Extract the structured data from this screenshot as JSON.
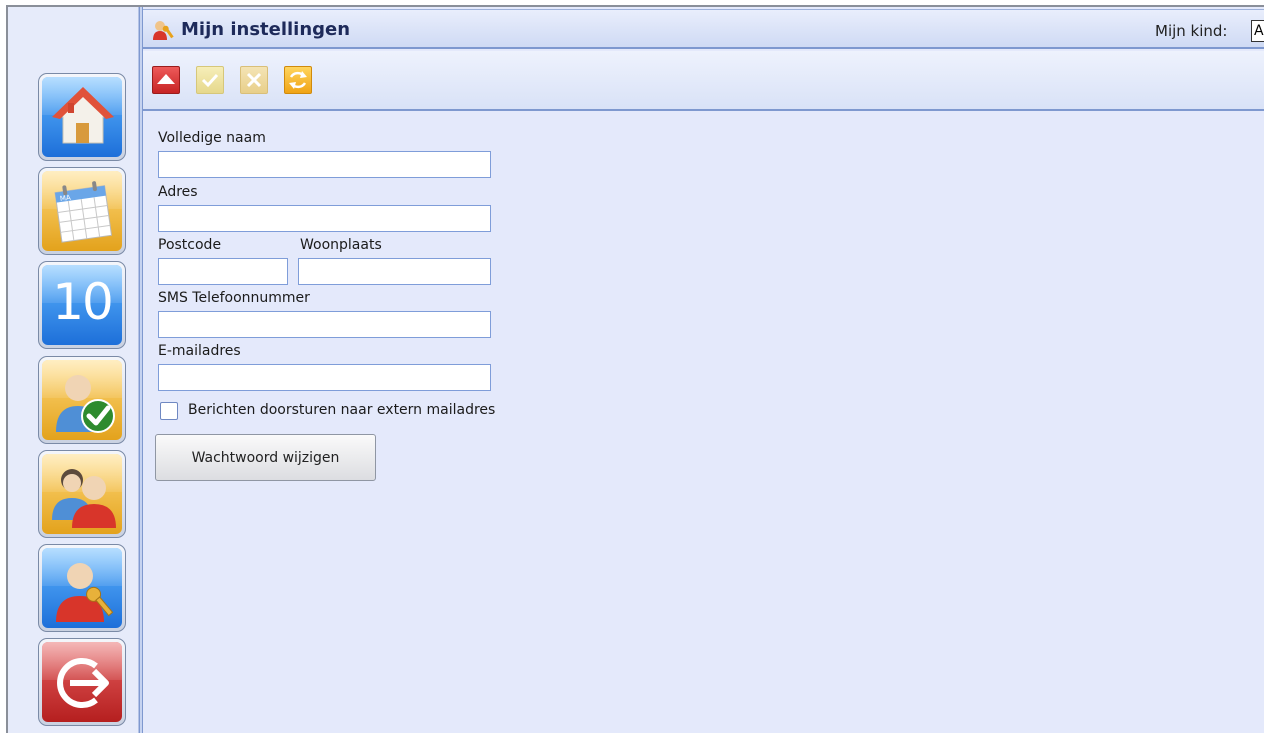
{
  "header": {
    "title": "Mijn instellingen",
    "kid_label": "Mijn kind:",
    "kid_value": "A"
  },
  "sidebar": {
    "items": [
      {
        "name": "home",
        "icon": "house-icon",
        "color": "blue"
      },
      {
        "name": "calendar",
        "icon": "calendar-icon",
        "color": "gold",
        "day_label": "MA"
      },
      {
        "name": "grades",
        "icon": "number-icon",
        "color": "blue",
        "text": "10"
      },
      {
        "name": "attendance",
        "icon": "person-check-icon",
        "color": "gold"
      },
      {
        "name": "contacts",
        "icon": "people-icon",
        "color": "gold"
      },
      {
        "name": "settings",
        "icon": "person-key-icon",
        "color": "blue"
      },
      {
        "name": "logout",
        "icon": "logout-arrow-icon",
        "color": "red"
      }
    ]
  },
  "toolbar": {
    "buttons": [
      "up-arrow-icon",
      "checkmark-icon",
      "close-icon",
      "refresh-icon"
    ]
  },
  "form": {
    "full_name_label": "Volledige naam",
    "full_name_value": "",
    "address_label": "Adres",
    "address_value": "",
    "postcode_label": "Postcode",
    "postcode_value": "",
    "city_label": "Woonplaats",
    "city_value": "",
    "sms_label": "SMS Telefoonnummer",
    "sms_value": "",
    "email_label": "E-mailadres",
    "email_value": "",
    "forward_label": "Berichten doorsturen naar extern mailadres",
    "forward_checked": false,
    "password_button": "Wachtwoord wijzigen"
  },
  "colors": {
    "background": "#e4e9fb",
    "header_text": "#1e2a5a",
    "field_border": "#7f9dd9"
  }
}
